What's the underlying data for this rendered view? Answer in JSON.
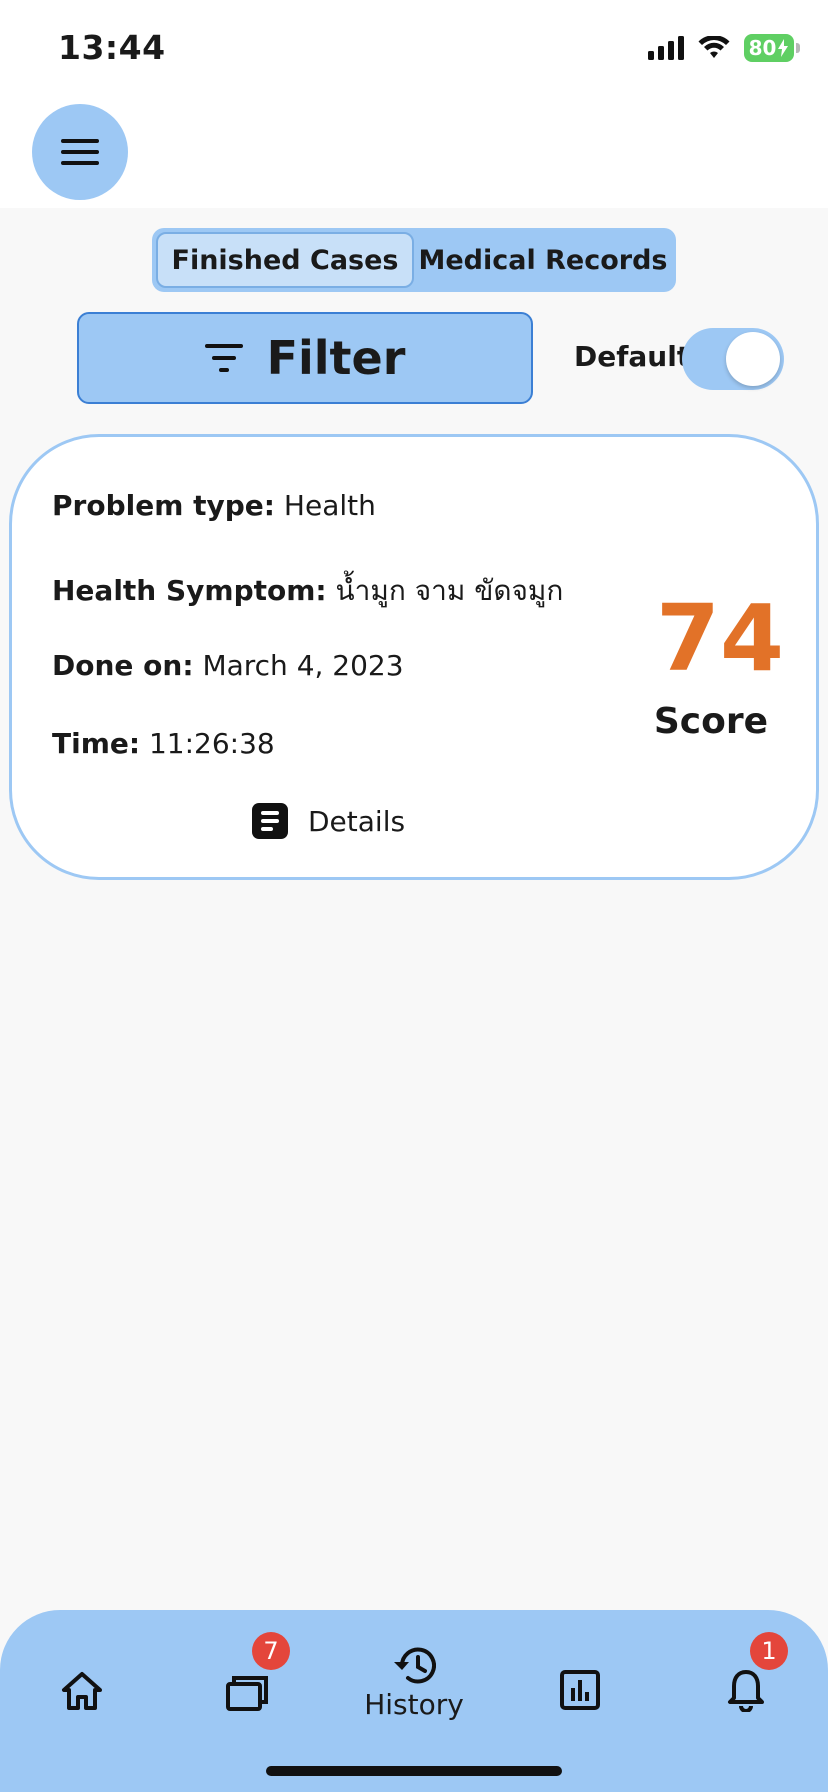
{
  "status_bar": {
    "time": "13:44",
    "battery": "80",
    "icons": [
      "signal-icon",
      "wifi-icon",
      "battery-charging-icon"
    ]
  },
  "header": {
    "menu_icon": "hamburger-menu-icon"
  },
  "tabs": [
    {
      "label": "Finished Cases",
      "active": true
    },
    {
      "label": "Medical Records",
      "active": false
    }
  ],
  "filter": {
    "label": "Filter",
    "icon": "filter-icon",
    "toggle_label": "Default",
    "toggle_on": true
  },
  "case_card": {
    "problem_type_label": "Problem type:",
    "problem_type_value": "Health",
    "symptom_label": "Health Symptom:",
    "symptom_value": "น้ำมูก จาม ขัดจมูก",
    "done_on_label": "Done on:",
    "done_on_value": "March 4, 2023",
    "time_label": "Time:",
    "time_value": "11:26:38",
    "score_value": "74",
    "score_label": "Score",
    "details_label": "Details",
    "details_icon": "document-icon"
  },
  "bottom_nav": {
    "items": [
      {
        "icon": "home-icon",
        "label": ""
      },
      {
        "icon": "cases-icon",
        "label": "",
        "badge": "7"
      },
      {
        "icon": "history-icon",
        "label": "History",
        "active": true
      },
      {
        "icon": "chart-icon",
        "label": ""
      },
      {
        "icon": "bell-icon",
        "label": "",
        "badge": "1"
      }
    ]
  },
  "colors": {
    "accent": "#9dc8f4",
    "score": "#e27228",
    "badge": "#e4463b",
    "border": "#3b7fd4"
  }
}
